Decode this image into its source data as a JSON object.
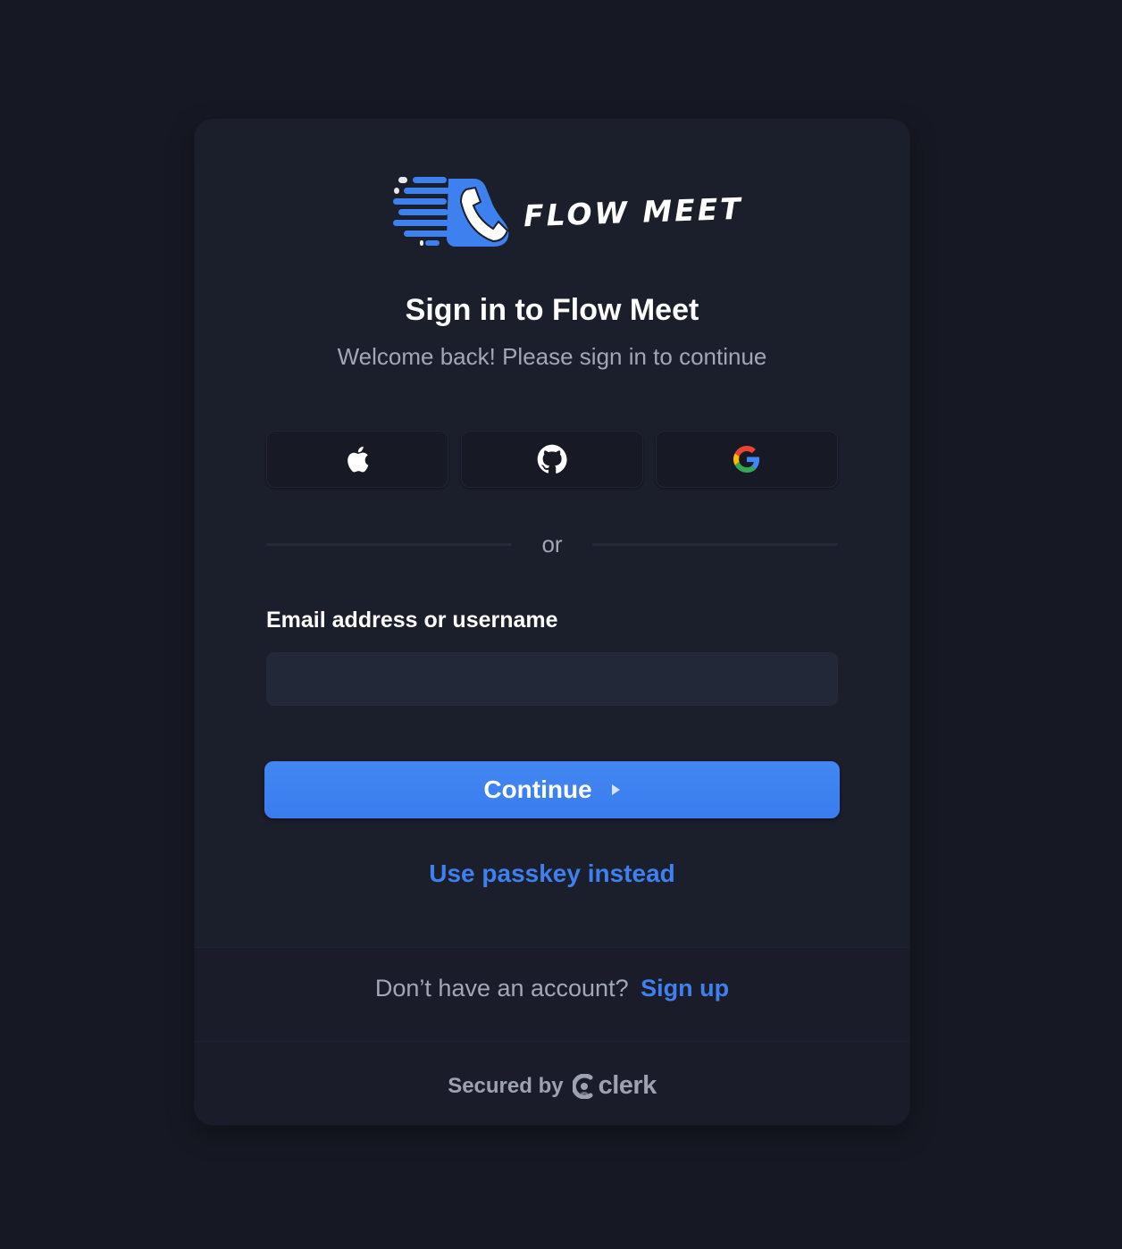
{
  "app": {
    "name": "Flow Meet",
    "logo_text": "FLOW MEET"
  },
  "header": {
    "title": "Sign in to Flow Meet",
    "subtitle": "Welcome back! Please sign in to continue"
  },
  "social_buttons": [
    {
      "icon": "apple-icon"
    },
    {
      "icon": "github-icon"
    },
    {
      "icon": "google-icon"
    }
  ],
  "divider": {
    "text": "or"
  },
  "form": {
    "email_label": "Email address or username",
    "email_value": "",
    "continue_label": "Continue",
    "passkey_label": "Use passkey instead"
  },
  "footer": {
    "signup_prompt": "Don’t have an account?",
    "signup_link": "Sign up",
    "secured_by": "Secured by",
    "provider": "clerk"
  },
  "colors": {
    "background": "#161923",
    "card": "#1b1e2b",
    "accent": "#3f80ef",
    "muted_text": "#a2a7b6"
  }
}
